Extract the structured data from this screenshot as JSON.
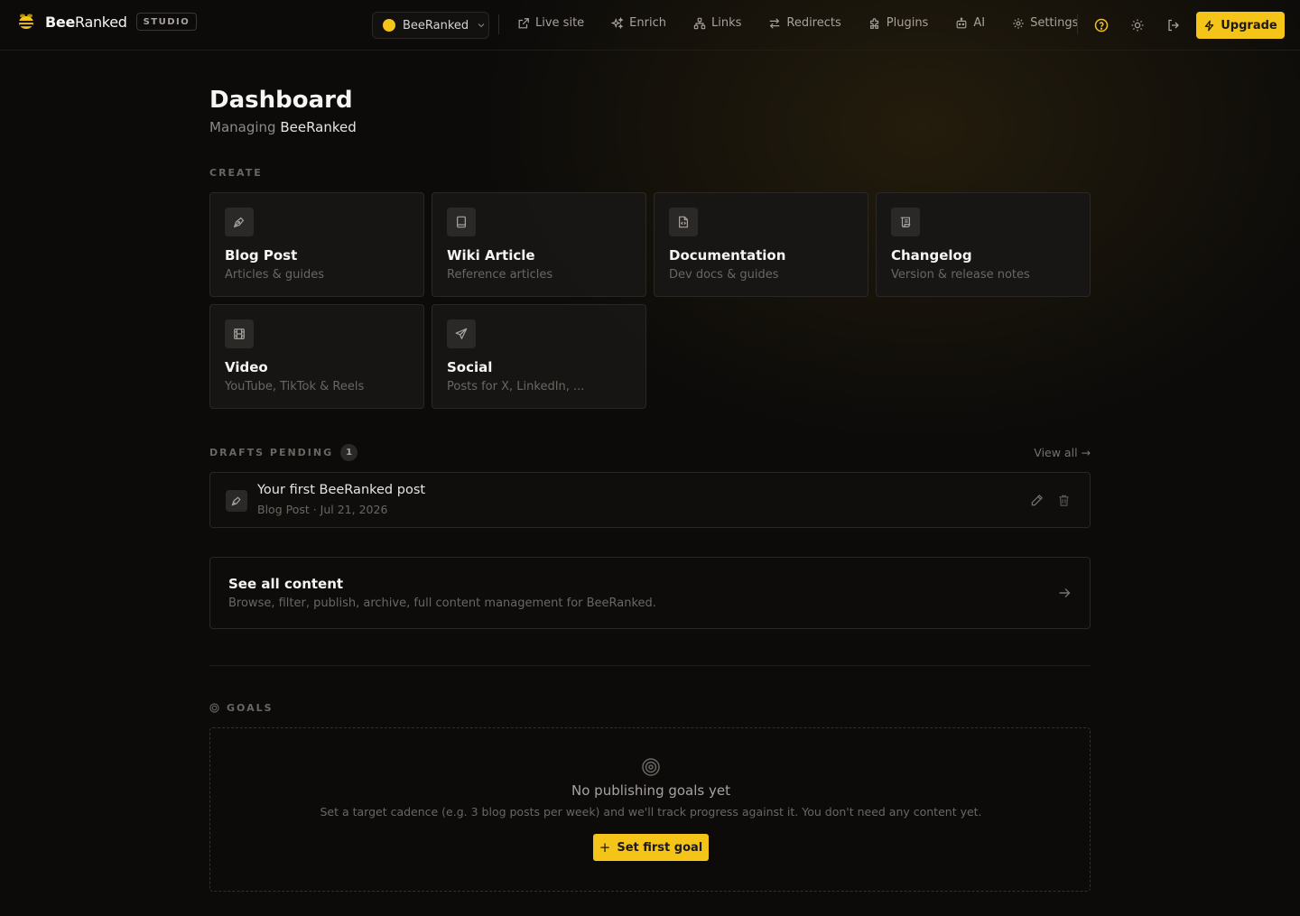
{
  "brand": {
    "name_bold": "Bee",
    "name_rest": "Ranked",
    "badge": "STUDIO"
  },
  "header": {
    "site_selector": {
      "value": "BeeRanked",
      "dot_color": "#f5c418"
    },
    "nav": [
      {
        "label": "Live site",
        "icon": "external-link-icon"
      },
      {
        "label": "Enrich",
        "icon": "sparkles-icon"
      },
      {
        "label": "Links",
        "icon": "network-icon"
      },
      {
        "label": "Redirects",
        "icon": "arrows-swap-icon"
      },
      {
        "label": "Plugins",
        "icon": "puzzle-icon"
      },
      {
        "label": "AI",
        "icon": "robot-icon"
      },
      {
        "label": "Settings",
        "icon": "gear-icon"
      }
    ],
    "upgrade_label": "Upgrade",
    "accent_color": "#f5c418"
  },
  "page": {
    "title": "Dashboard",
    "subtitle_prefix": "Managing",
    "subtitle_site": "BeeRanked"
  },
  "create": {
    "label": "CREATE",
    "cards": [
      {
        "title": "Blog Post",
        "subtitle": "Articles & guides",
        "icon": "pen-nib-icon"
      },
      {
        "title": "Wiki Article",
        "subtitle": "Reference articles",
        "icon": "book-icon"
      },
      {
        "title": "Documentation",
        "subtitle": "Dev docs & guides",
        "icon": "file-code-icon"
      },
      {
        "title": "Changelog",
        "subtitle": "Version & release notes",
        "icon": "scroll-icon"
      },
      {
        "title": "Video",
        "subtitle": "YouTube, TikTok & Reels",
        "icon": "film-icon"
      },
      {
        "title": "Social",
        "subtitle": "Posts for X, LinkedIn, ...",
        "icon": "send-icon"
      }
    ]
  },
  "drafts": {
    "label": "DRAFTS PENDING",
    "count": "1",
    "view_all": "View all →",
    "items": [
      {
        "title": "Your first BeeRanked post",
        "meta": "Blog Post · Jul 21, 2026"
      }
    ]
  },
  "see_all": {
    "title": "See all content",
    "subtitle": "Browse, filter, publish, archive, full content management for BeeRanked."
  },
  "goals": {
    "label": "GOALS",
    "empty_title": "No publishing goals yet",
    "empty_sub": "Set a target cadence (e.g. 3 blog posts per week) and we'll track progress against it. You don't need any content yet.",
    "button_label": "Set first goal"
  }
}
